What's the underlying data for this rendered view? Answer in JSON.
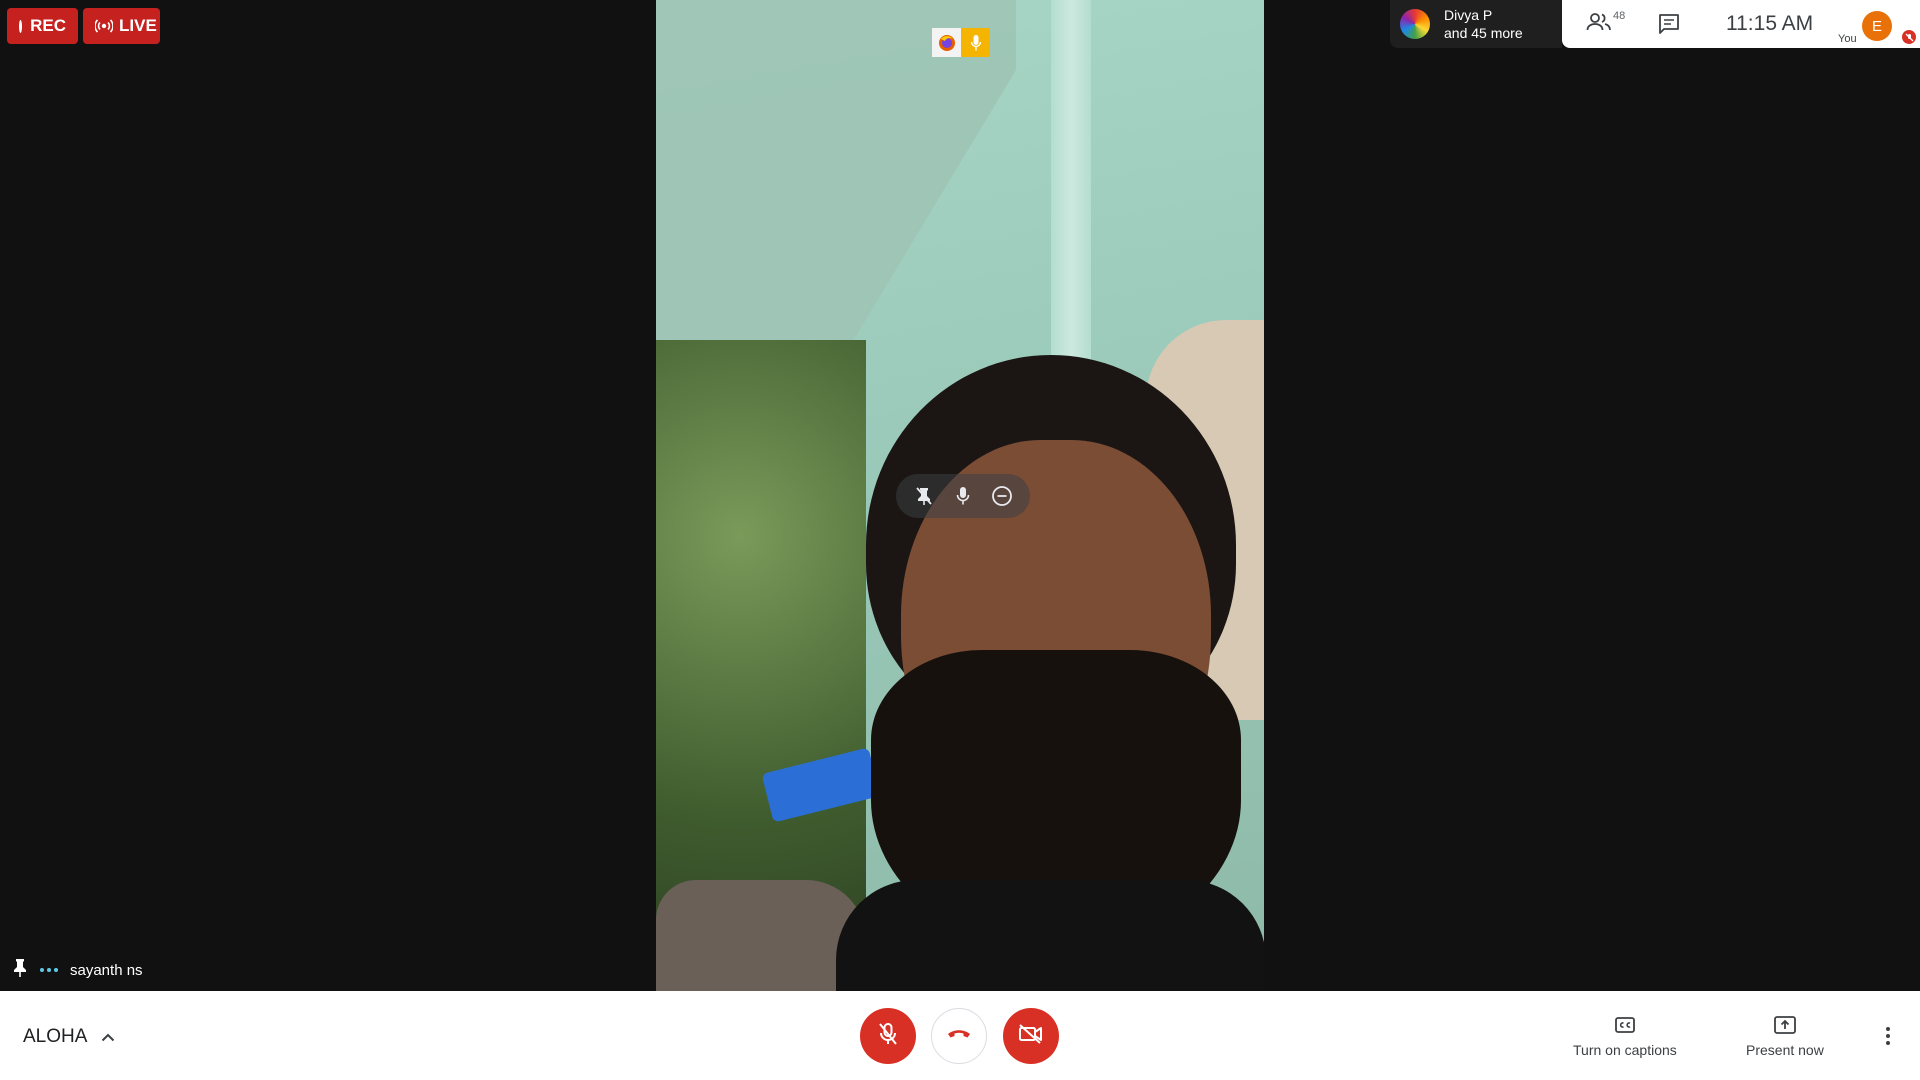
{
  "recording": {
    "rec_label": "REC",
    "live_label": "LIVE"
  },
  "tile": {
    "participant_name": "sayanth ns",
    "overlay_icons": [
      "firefox-icon",
      "mic-icon"
    ],
    "controls": [
      "pin-off-icon",
      "mic-icon",
      "remove-icon"
    ]
  },
  "participants_chip": {
    "line1": "Divya P",
    "line2": "and 45 more"
  },
  "topbar": {
    "people_count": "48",
    "time": "11:15 AM",
    "self_initial": "E",
    "self_label": "You"
  },
  "bottombar": {
    "meeting_name": "ALOHA",
    "captions_label": "Turn on captions",
    "present_label": "Present now"
  },
  "colors": {
    "danger": "#d93025",
    "badge": "#c5221f",
    "self_avatar": "#e8710a"
  }
}
